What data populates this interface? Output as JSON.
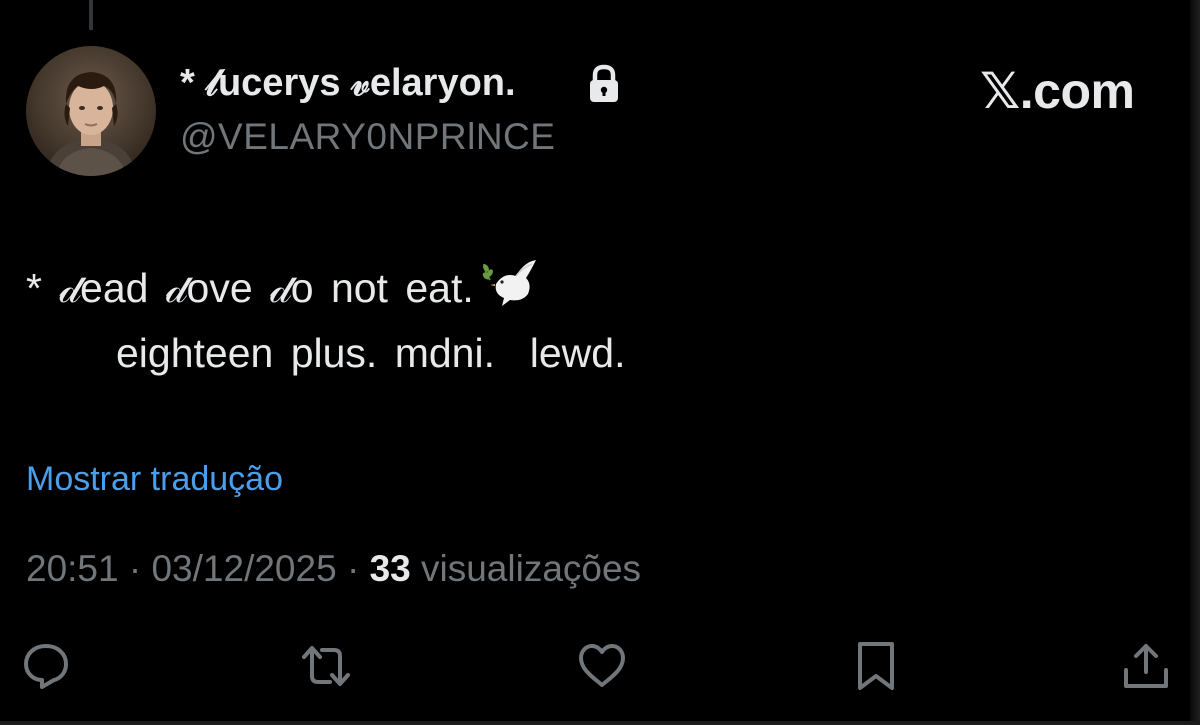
{
  "author": {
    "display_name": "* 𝓁ucerys 𝓋elaryon.",
    "handle": "@VELARY0NPRlNCE",
    "avatar_icon": "person-portrait-avatar",
    "protected_icon": "lock-icon"
  },
  "brand": {
    "watermark": "𝕏.com"
  },
  "tweet": {
    "line1": "* 𝒹ead 𝒹ove 𝒹o not eat.",
    "line1_emoji": "dove-icon",
    "line2": "eighteen plus. mdni.  lewd."
  },
  "translate_link": "Mostrar tradução",
  "meta": {
    "time": "20:51",
    "separator": "·",
    "date": "03/12/2025",
    "views_count": "33",
    "views_label": "visualizações"
  },
  "actions": [
    "reply-icon",
    "retweet-icon",
    "like-icon",
    "bookmark-icon",
    "share-icon"
  ],
  "colors": {
    "background": "#000000",
    "primary_text": "#e7e9ea",
    "secondary_text": "#71767b",
    "link": "#4a9eea"
  }
}
